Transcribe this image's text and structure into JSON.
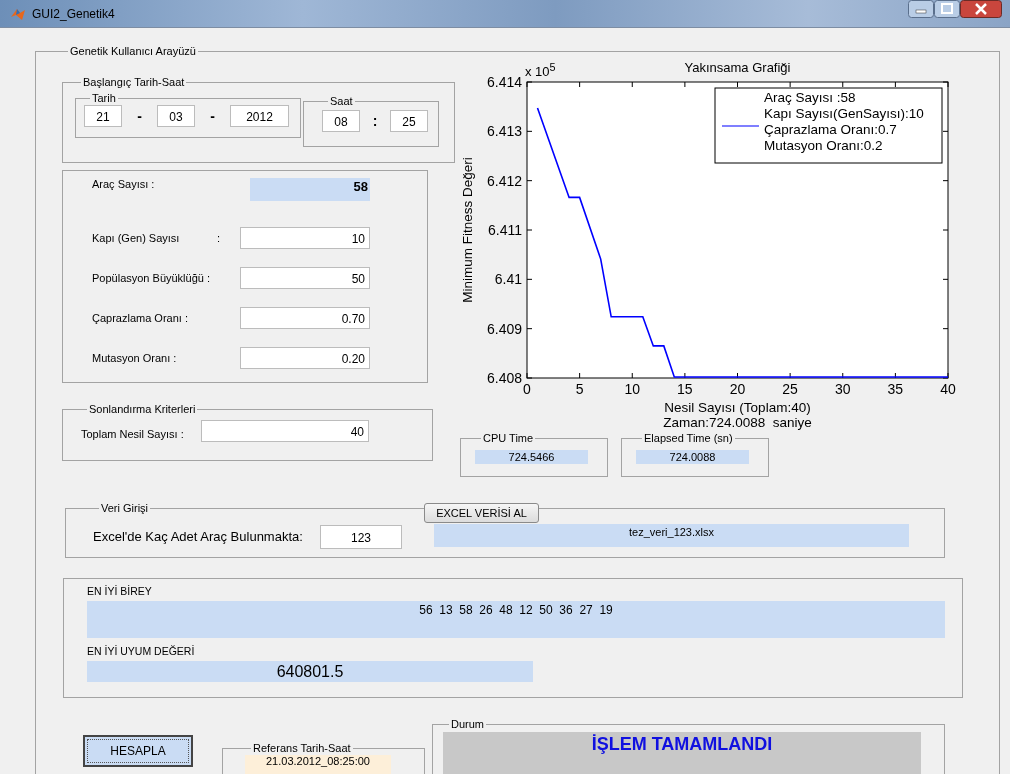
{
  "window": {
    "title": "GUI2_Genetik4"
  },
  "main_panel": {
    "title": "Genetik Kullanıcı Arayüzü"
  },
  "start_datetime": {
    "title": "Başlangıç Tarih-Saat",
    "date": {
      "title": "Tarih",
      "day": "21",
      "month": "03",
      "year": "2012",
      "separators": [
        "-",
        "-"
      ]
    },
    "time": {
      "title": "Saat",
      "hour": "08",
      "minute": "25",
      "separator": ":"
    }
  },
  "parameters": [
    {
      "label": "Araç Sayısı :",
      "value": "58",
      "kind": "display"
    },
    {
      "label": "Kapı (Gen) Sayısı",
      "suffix": ":",
      "value": "10",
      "kind": "input"
    },
    {
      "label": "Popülasyon Büyüklüğü :",
      "value": "50",
      "kind": "input"
    },
    {
      "label": "Çaprazlama Oranı :",
      "value": "0.70",
      "kind": "input"
    },
    {
      "label": "Mutasyon Oranı :",
      "value": "0.20",
      "kind": "input"
    }
  ],
  "termination": {
    "title": "Sonlandırma Kriterleri",
    "label": "Toplam Nesil Sayısı :",
    "value": "40"
  },
  "chart": {
    "axis_multiplier": "x 10$^{5}$",
    "caption": "Zaman:724.0088  saniye",
    "chart_data": {
      "type": "line",
      "title": "Yakınsama Grafiği",
      "xlabel": "Nesil Sayısı (Toplam:40)",
      "ylabel": "Minimum Fitness Değeri",
      "x": [
        1,
        4,
        5,
        7,
        8,
        11,
        12,
        13,
        14,
        40
      ],
      "series": [
        {
          "name": "Araç Sayısı :58\nKapı Sayısı(GenSayısı):10\nÇaprazlama Oranı:0.7\nMutasyon Oranı:0.2",
          "color": "#0000ff",
          "values": [
            6.41345,
            6.41164,
            6.41164,
            6.41039,
            6.40922,
            6.40922,
            6.40863,
            6.40863,
            6.408,
            6.408
          ]
        }
      ],
      "xlim": [
        0,
        40
      ],
      "ylim": [
        6.408,
        6.414
      ],
      "xticks": [
        0,
        5,
        10,
        15,
        20,
        25,
        30,
        35,
        40
      ],
      "yticks": [
        {
          "value": 6.408,
          "label": "6.408"
        },
        {
          "value": 6.409,
          "label": "6.409"
        },
        {
          "value": 6.41,
          "label": "6.41"
        },
        {
          "value": 6.411,
          "label": "6.411"
        },
        {
          "value": 6.412,
          "label": "6.412"
        },
        {
          "value": 6.413,
          "label": "6.413"
        },
        {
          "value": 6.414,
          "label": "6.414"
        }
      ]
    }
  },
  "cpu_time": {
    "title": "CPU Time",
    "value": "724.5466"
  },
  "elapsed_time": {
    "title": "Elapsed Time (sn)",
    "value": "724.0088"
  },
  "data_input": {
    "title": "Veri Girişi",
    "label": "Excel'de Kaç Adet Araç Bulunmakta:",
    "count": "123",
    "button": "EXCEL VERİSİ AL",
    "file": "tez_veri_123.xlsx"
  },
  "best": {
    "individual_label": "EN İYİ BİREY",
    "individual": "56  13  58  26  48  12  50  36  27  19",
    "fitness_label": "EN İYİ UYUM DEĞERİ",
    "fitness": "640801.5"
  },
  "calculate_button": "HESAPLA",
  "reference": {
    "title": "Referans Tarih-Saat",
    "value": "21.03.2012_08:25:00"
  },
  "status": {
    "title": "Durum",
    "message": "İŞLEM TAMAMLANDI"
  }
}
